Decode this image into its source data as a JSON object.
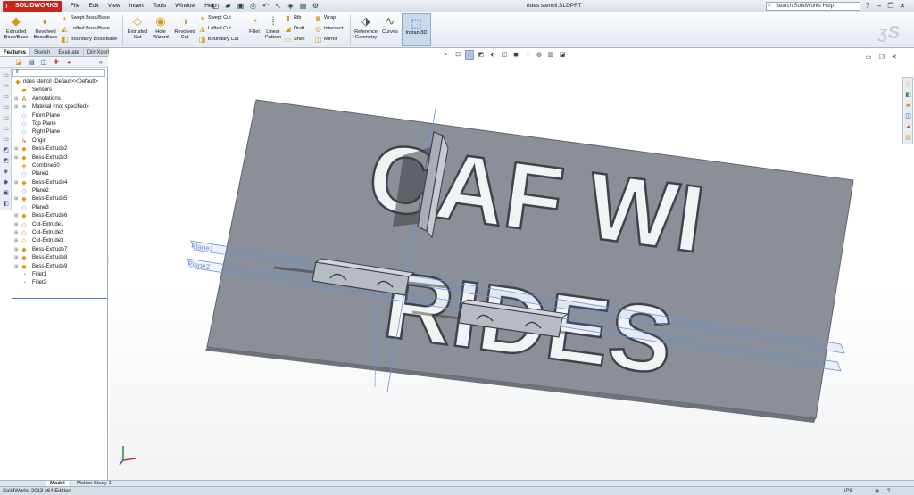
{
  "app": {
    "brand": "SOLIDWORKS",
    "menus": [
      "File",
      "Edit",
      "View",
      "Insert",
      "Tools",
      "Window",
      "Help"
    ],
    "document_title": "rides stencil.SLDPRT",
    "search_placeholder": "Search SolidWorks Help"
  },
  "commands": {
    "extruded_boss": "Extruded Boss/Base",
    "revolved_boss": "Revolved Boss/Base",
    "swept_boss": "Swept Boss/Base",
    "lofted_boss": "Lofted Boss/Base",
    "boundary_boss": "Boundary Boss/Base",
    "extruded_cut": "Extruded Cut",
    "hole_wizard": "Hole Wizard",
    "revolved_cut": "Revolved Cut",
    "swept_cut": "Swept Cut",
    "lofted_cut": "Lofted Cut",
    "boundary_cut": "Boundary Cut",
    "fillet": "Fillet",
    "linear_pattern": "Linear Pattern",
    "rib": "Rib",
    "draft": "Draft",
    "shell": "Shell",
    "wrap": "Wrap",
    "intersect": "Intersect",
    "mirror": "Mirror",
    "reference_geometry": "Reference Geometry",
    "curves": "Curves",
    "instant3d": "Instant3D"
  },
  "panel": {
    "tabs": [
      "Features",
      "Sketch",
      "Evaluate",
      "DimXpert"
    ],
    "active_tab": "Features",
    "tree": [
      {
        "label": "rides stencil  (Default<<Default>",
        "icon": "part-icon",
        "root": true
      },
      {
        "label": "Sensors",
        "icon": "sensors-folder-icon",
        "expand": false
      },
      {
        "label": "Annotations",
        "icon": "annotations-icon",
        "expand": true
      },
      {
        "label": "Material <not specified>",
        "icon": "material-icon",
        "expand": true
      },
      {
        "label": "Front Plane",
        "icon": "plane-icon",
        "expand": false
      },
      {
        "label": "Top Plane",
        "icon": "plane-icon",
        "expand": false
      },
      {
        "label": "Right Plane",
        "icon": "plane-icon",
        "expand": false
      },
      {
        "label": "Origin",
        "icon": "origin-icon",
        "expand": false
      },
      {
        "label": "Boss-Extrude2",
        "icon": "extrude-icon",
        "expand": true
      },
      {
        "label": "Boss-Extrude3",
        "icon": "extrude-icon",
        "expand": true
      },
      {
        "label": "Combine50",
        "icon": "combine-icon",
        "expand": false
      },
      {
        "label": "Plane1",
        "icon": "plane-icon",
        "expand": false
      },
      {
        "label": "Boss-Extrude4",
        "icon": "extrude-icon",
        "expand": true
      },
      {
        "label": "Plane2",
        "icon": "plane-icon",
        "expand": false
      },
      {
        "label": "Boss-Extrude5",
        "icon": "extrude-icon",
        "expand": true
      },
      {
        "label": "Plane3",
        "icon": "plane-icon",
        "expand": false
      },
      {
        "label": "Boss-Extrude6",
        "icon": "extrude-icon",
        "expand": true
      },
      {
        "label": "Cut-Extrude1",
        "icon": "cut-icon",
        "expand": true
      },
      {
        "label": "Cut-Extrude2",
        "icon": "cut-icon",
        "expand": true
      },
      {
        "label": "Cut-Extrude3",
        "icon": "cut-icon",
        "expand": true
      },
      {
        "label": "Boss-Extrude7",
        "icon": "extrude-icon",
        "expand": true
      },
      {
        "label": "Boss-Extrude8",
        "icon": "extrude-icon",
        "expand": true
      },
      {
        "label": "Boss-Extrude9",
        "icon": "extrude-icon",
        "expand": true
      },
      {
        "label": "Fillet1",
        "icon": "fillet-icon",
        "expand": false
      },
      {
        "label": "Fillet2",
        "icon": "fillet-icon",
        "expand": false
      }
    ]
  },
  "viewport": {
    "plane_label_1": "Plane1",
    "plane_label_2": "Plane2",
    "stencil_line1": "CAF WI",
    "stencil_line2": "RIDES",
    "plate_color": "#8a8f98",
    "plane_color": "#6f93d6"
  },
  "bottom": {
    "model_tab": "Model",
    "motion_tab": "Motion Study 1"
  },
  "status": {
    "edition": "SolidWorks 2013 x64 Edition",
    "units": "IPS"
  }
}
